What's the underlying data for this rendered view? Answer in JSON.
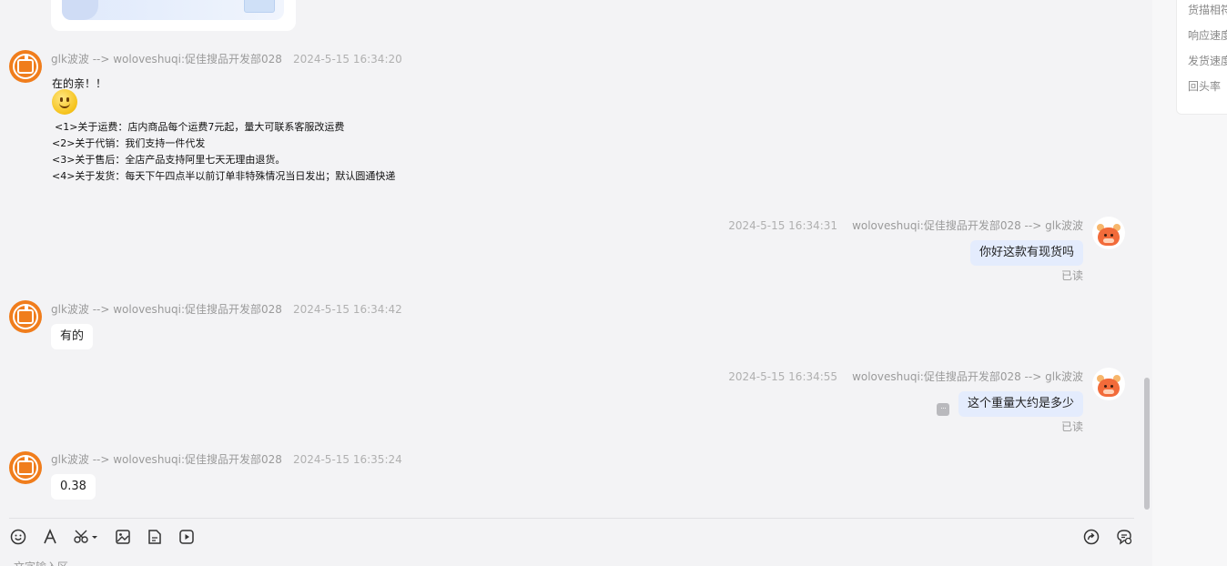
{
  "right_panel": {
    "items": [
      "货描相符",
      "响应速度",
      "发货速度",
      "回头率"
    ]
  },
  "messages": [
    {
      "sender": "glk波波 --> woloveshuqi:促佳搜品开发部028",
      "time": "2024-5-15 16:34:20",
      "lines": [
        "在的亲！！",
        "<1>关于运费：店内商品每个运费7元起，量大可联系客服改运费",
        "<2>关于代销：我们支持一件代发",
        "<3>关于售后：全店产品支持阿里七天无理由退货。",
        "<4>关于发货：每天下午四点半以前订单非特殊情况当日发出；默认圆通快递"
      ]
    },
    {
      "sender": "woloveshuqi:促佳搜品开发部028 --> glk波波",
      "time": "2024-5-15 16:34:31",
      "text": "你好这款有现货吗",
      "status": "已读"
    },
    {
      "sender": "glk波波 --> woloveshuqi:促佳搜品开发部028",
      "time": "2024-5-15 16:34:42",
      "text": "有的"
    },
    {
      "sender": "woloveshuqi:促佳搜品开发部028 --> glk波波",
      "time": "2024-5-15 16:34:55",
      "text": "这个重量大约是多少",
      "status": "已读"
    },
    {
      "sender": "glk波波 --> woloveshuqi:促佳搜品开发部028",
      "time": "2024-5-15 16:35:24",
      "text": "0.38"
    }
  ],
  "toolbar": {
    "icons": [
      "emoji-icon",
      "font-icon",
      "scissors-icon",
      "image-icon",
      "file-icon",
      "video-icon",
      "forward-icon",
      "chat-settings-icon"
    ]
  },
  "input": {
    "hint": "文字输入区"
  }
}
